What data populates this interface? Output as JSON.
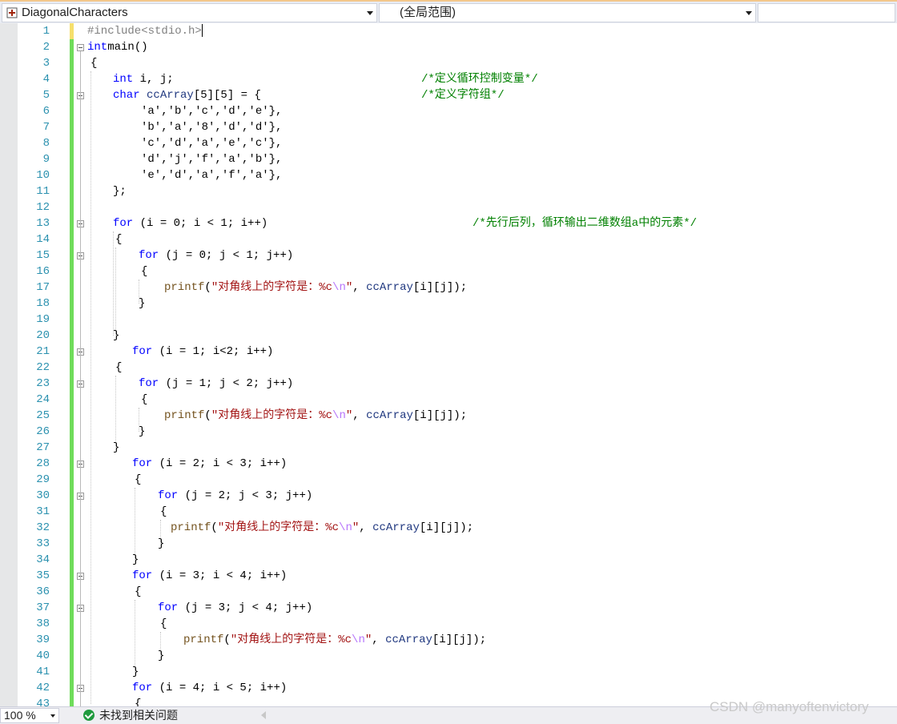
{
  "navbar": {
    "project_name": "DiagonalCharacters",
    "scope": "(全局范围)",
    "member": ""
  },
  "editor": {
    "lines": [
      [
        [
          "pp",
          "#include<stdio.h>"
        ]
      ],
      [
        [
          "kw",
          "int"
        ],
        [
          "",
          "main()"
        ]
      ],
      [
        [
          "",
          "{"
        ]
      ],
      [
        [
          "kw",
          "int"
        ],
        [
          "",
          " i, j;"
        ]
      ],
      [
        [
          "kw",
          "char"
        ],
        [
          "",
          " "
        ],
        [
          "var",
          "ccArray"
        ],
        [
          "",
          "[5][5] = {"
        ]
      ],
      [
        [
          "",
          "'a','b','c','d','e'},"
        ]
      ],
      [
        [
          "",
          "'b','a','8','d','d'},"
        ]
      ],
      [
        [
          "",
          "'c','d','a','e','c'},"
        ]
      ],
      [
        [
          "",
          "'d','j','f','a','b'},"
        ]
      ],
      [
        [
          "",
          "'e','d','a','f','a'},"
        ]
      ],
      [
        [
          "",
          "};"
        ]
      ],
      [],
      [
        [
          "kw",
          "for"
        ],
        [
          "",
          " (i = 0; i < 1; i++)"
        ]
      ],
      [
        [
          "",
          "{"
        ]
      ],
      [
        [
          "kw",
          "for"
        ],
        [
          "",
          " (j = 0; j < 1; j++)"
        ]
      ],
      [
        [
          "",
          "{"
        ]
      ],
      [
        [
          "fn",
          "printf"
        ],
        [
          "",
          "("
        ],
        [
          "str",
          "\"对角线上的字符是：%c"
        ],
        [
          "esc",
          "\\n"
        ],
        [
          "str",
          "\""
        ],
        [
          "",
          ", "
        ],
        [
          "var",
          "ccArray"
        ],
        [
          "",
          "[i][j]);"
        ]
      ],
      [
        [
          "",
          "}"
        ]
      ],
      [],
      [
        [
          "",
          "}"
        ]
      ],
      [
        [
          "kw",
          "for"
        ],
        [
          "",
          " (i = 1; i<2; i++)"
        ]
      ],
      [
        [
          "",
          "{"
        ]
      ],
      [
        [
          "kw",
          "for"
        ],
        [
          "",
          " (j = 1; j < 2; j++)"
        ]
      ],
      [
        [
          "",
          "{"
        ]
      ],
      [
        [
          "fn",
          "printf"
        ],
        [
          "",
          "("
        ],
        [
          "str",
          "\"对角线上的字符是：%c"
        ],
        [
          "esc",
          "\\n"
        ],
        [
          "str",
          "\""
        ],
        [
          "",
          ", "
        ],
        [
          "var",
          "ccArray"
        ],
        [
          "",
          "[i][j]);"
        ]
      ],
      [
        [
          "",
          "}"
        ]
      ],
      [
        [
          "",
          "}"
        ]
      ],
      [
        [
          "kw",
          "for"
        ],
        [
          "",
          " (i = 2; i < 3; i++)"
        ]
      ],
      [
        [
          "",
          "{"
        ]
      ],
      [
        [
          "kw",
          "for"
        ],
        [
          "",
          " (j = 2; j < 3; j++)"
        ]
      ],
      [
        [
          "",
          "{"
        ]
      ],
      [
        [
          "fn",
          "printf"
        ],
        [
          "",
          "("
        ],
        [
          "str",
          "\"对角线上的字符是：%c"
        ],
        [
          "esc",
          "\\n"
        ],
        [
          "str",
          "\""
        ],
        [
          "",
          ", "
        ],
        [
          "var",
          "ccArray"
        ],
        [
          "",
          "[i][j]);"
        ]
      ],
      [
        [
          "",
          "}"
        ]
      ],
      [
        [
          "",
          "}"
        ]
      ],
      [
        [
          "kw",
          "for"
        ],
        [
          "",
          " (i = 3; i < 4; i++)"
        ]
      ],
      [
        [
          "",
          "{"
        ]
      ],
      [
        [
          "kw",
          "for"
        ],
        [
          "",
          " (j = 3; j < 4; j++)"
        ]
      ],
      [
        [
          "",
          "{"
        ]
      ],
      [
        [
          "fn",
          "printf"
        ],
        [
          "",
          "("
        ],
        [
          "str",
          "\"对角线上的字符是：%c"
        ],
        [
          "esc",
          "\\n"
        ],
        [
          "str",
          "\""
        ],
        [
          "",
          ", "
        ],
        [
          "var",
          "ccArray"
        ],
        [
          "",
          "[i][j]);"
        ]
      ],
      [
        [
          "",
          "}"
        ]
      ],
      [
        [
          "",
          "}"
        ]
      ],
      [
        [
          "kw",
          "for"
        ],
        [
          "",
          " (i = 4; i < 5; i++)"
        ]
      ],
      [
        [
          "",
          "{"
        ]
      ]
    ],
    "comments": [
      {
        "line": 4,
        "text": "/*定义循环控制变量*/"
      },
      {
        "line": 5,
        "text": "/*定义字符组*/"
      },
      {
        "line": 13,
        "text": "/*先行后列，循环输出二维数组a中的元素*/"
      }
    ]
  },
  "status": {
    "zoom": "100 %",
    "issues": "未找到相关问题"
  },
  "watermark": "CSDN @manyoftenvictory",
  "colors": {
    "keyword": "#0000ff",
    "string": "#a31515",
    "comment": "#008000",
    "line_number": "#2b91af",
    "change_saved": "#6fdc5a",
    "change_unsaved": "#f6df6c"
  }
}
